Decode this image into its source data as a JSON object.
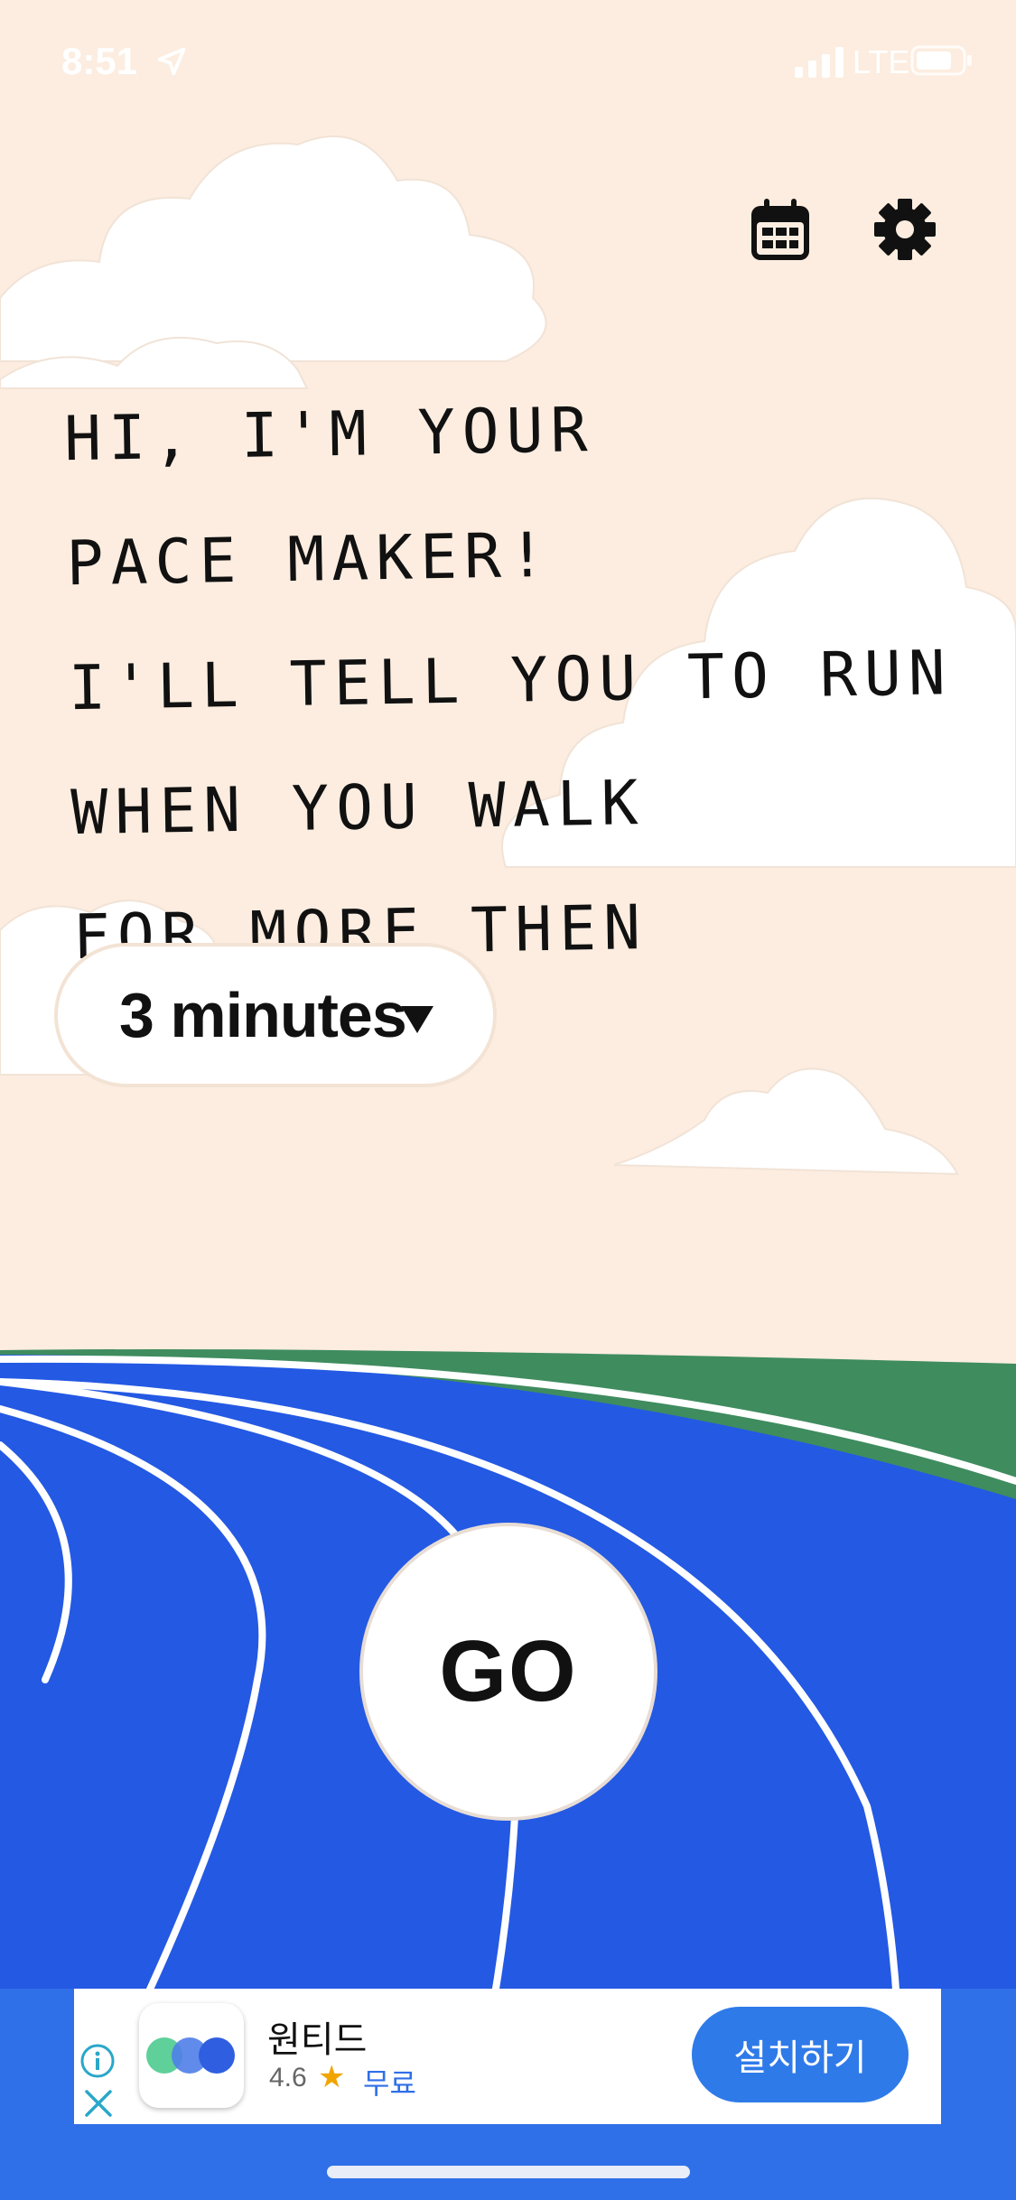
{
  "status_bar": {
    "time": "8:51",
    "network": "LTE",
    "location_icon": "location-arrow-icon",
    "signal_icon": "signal-bars-icon",
    "battery_icon": "battery-icon"
  },
  "toolbar": {
    "calendar_icon": "calendar-icon",
    "settings_icon": "gear-icon"
  },
  "message": {
    "lines": [
      "HI, I'M YOUR",
      "PACE MAKER!",
      "I'LL TELL YOU TO RUN",
      "WHEN YOU WALK",
      "FOR MORE THEN"
    ]
  },
  "duration": {
    "selected": "3 minutes",
    "dropdown_icon": "triangle-down-icon"
  },
  "go_button": {
    "label": "GO"
  },
  "ad": {
    "app_name": "원티드",
    "rating": "4.6",
    "price": "무료",
    "install_label": "설치하기",
    "info_icon": "info-icon",
    "close_icon": "close-icon",
    "star_icon": "star-icon"
  },
  "colors": {
    "sky": "#fcede0",
    "cloud": "#ffffff",
    "grass": "#3f8c5f",
    "track": "#2459e3",
    "track_lines": "#ffffff",
    "ad_background": "#2f6fe8",
    "install_button": "#2f7ae9"
  }
}
